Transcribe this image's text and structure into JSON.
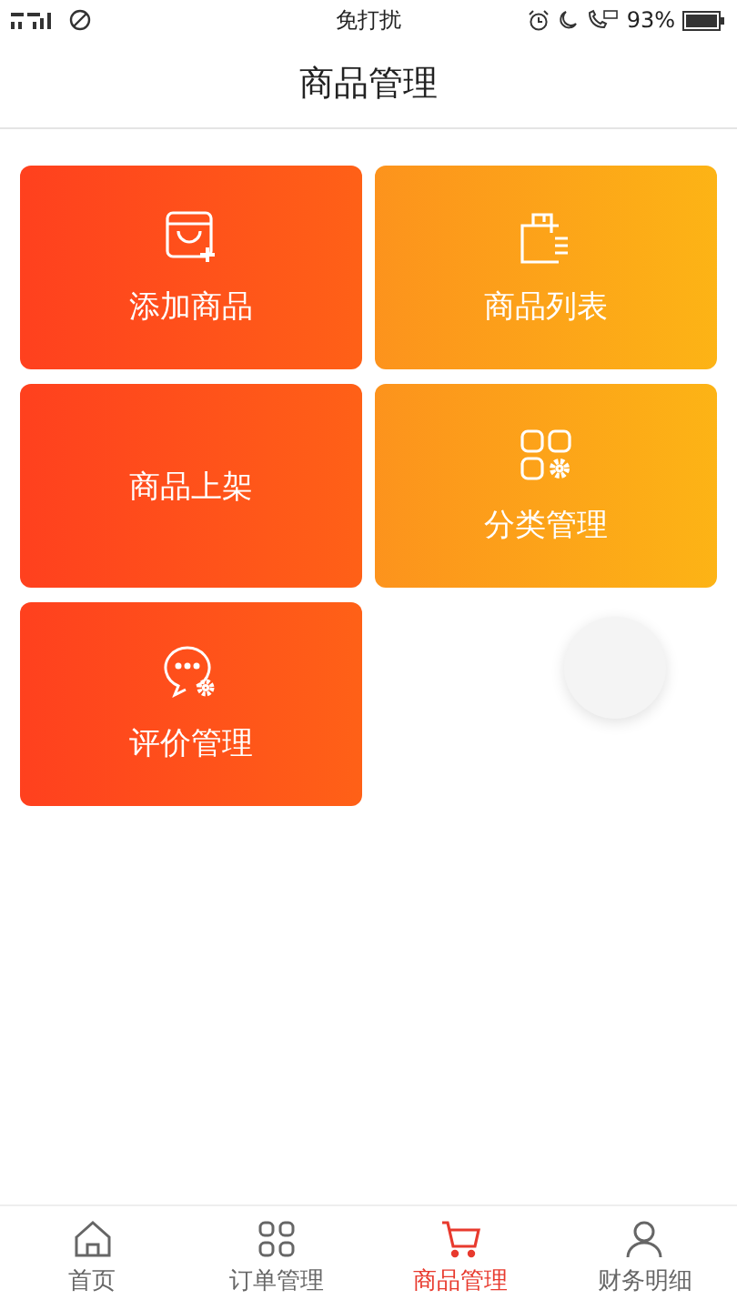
{
  "status_bar": {
    "mode": "免打扰",
    "battery": "93%"
  },
  "header": {
    "title": "商品管理"
  },
  "tiles": [
    {
      "label": "添加商品",
      "color": "#ff4a1c",
      "kind": "bag-add"
    },
    {
      "label": "商品列表",
      "color": "#fcaf1a",
      "kind": "bag-list"
    },
    {
      "label": "商品上架",
      "color": "#ff4a1c",
      "kind": "plain"
    },
    {
      "label": "分类管理",
      "color": "#fcaf1a",
      "kind": "grid-gear"
    },
    {
      "label": "评价管理",
      "color": "#ff4a1c",
      "kind": "chat-gear"
    }
  ],
  "tabs": [
    {
      "label": "首页",
      "kind": "home",
      "selected": false
    },
    {
      "label": "订单管理",
      "kind": "grid",
      "selected": false
    },
    {
      "label": "商品管理",
      "kind": "cart",
      "selected": true
    },
    {
      "label": "财务明细",
      "kind": "person",
      "selected": false
    }
  ]
}
